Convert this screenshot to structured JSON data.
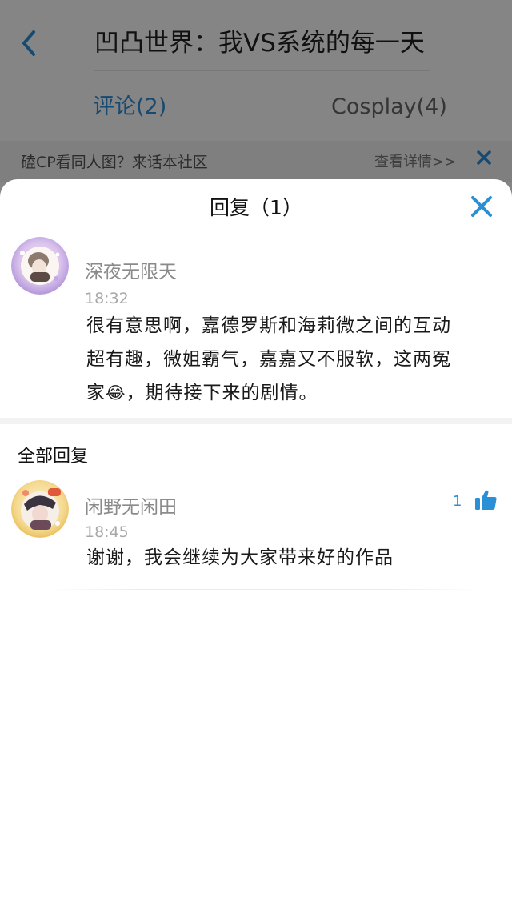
{
  "header": {
    "title": "凹凸世界：我VS系统的每一天",
    "back_icon": "chevron-left-icon",
    "tabs": [
      {
        "label": "评论(2)",
        "active": true
      },
      {
        "label": "Cosplay(4)",
        "active": false
      }
    ]
  },
  "banner": {
    "text": "磕CP看同人图？来话本社区",
    "link": "查看详情>>",
    "close_icon": "close-icon"
  },
  "sheet": {
    "title": "回复（1）",
    "close_icon": "close-icon",
    "comment": {
      "user": "深夜无限天",
      "time": "18:32",
      "text_line1": "很有意思啊，嘉德罗斯和海莉微之间的互动",
      "text_line2": "超有趣，微姐霸气，嘉嘉又不服软，这两冤",
      "text_line3_a": "家",
      "emoji": "😂",
      "text_line3_b": "，期待接下来的剧情。"
    },
    "section_title": "全部回复",
    "replies": [
      {
        "user": "闲野无闲田",
        "time": "18:45",
        "text": "谢谢，我会继续为大家带来好的作品",
        "likes": "1",
        "like_icon": "thumbs-up-icon"
      }
    ]
  },
  "colors": {
    "accent": "#2b8fd6",
    "overlay": "rgba(0,0,0,0.48)",
    "muted_text": "#8a8a8a"
  }
}
